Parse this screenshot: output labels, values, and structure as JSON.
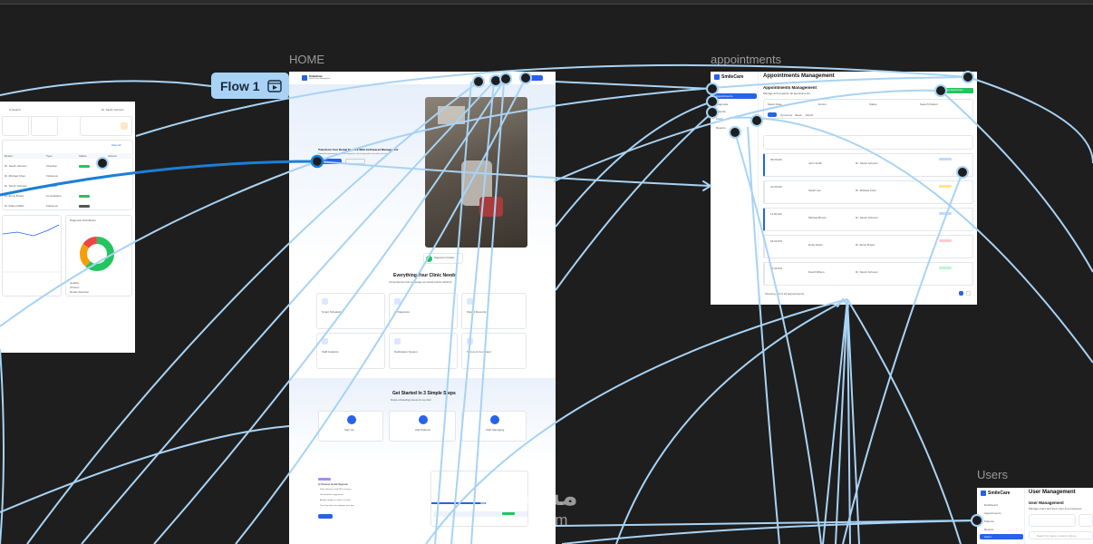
{
  "labels": {
    "home": "HOME",
    "appointments": "appointments",
    "users": "Users"
  },
  "flow": {
    "label": "Flow 1",
    "icon": "play-frame-icon"
  },
  "colors": {
    "canvas": "#1e1e1e",
    "wire": "#a8d3f5",
    "wire_active": "#1b7fd6",
    "accent": "#2563eb",
    "green": "#22c55e"
  },
  "dashboard": {
    "search": "Q  Search",
    "user": "Dr. Sarah Johnson",
    "view_all": "View all",
    "table_headers": [
      "Doctor",
      "Type",
      "Status",
      "Actions"
    ],
    "doctors": [
      "Dr. Sarah Johnson",
      "Dr. Michael Chen",
      "Dr. Sarah Johnson",
      "Dr. Emily Brown",
      "Dr. Robert Miller"
    ],
    "types": [
      "Checkup",
      "Follow-up",
      "Checkup",
      "Consultation",
      "Follow-up"
    ],
    "chart_title": "Diagnosis Distribution",
    "legend": [
      "Healthy",
      "Chronic",
      "Needs Attention"
    ]
  },
  "home": {
    "brand": "SmileCare",
    "tagline": "Dental Clinic Management",
    "hero_title": "Transform Your Dental Practice With AI-Powered Management",
    "hero_sub": "Streamline appointments, automate diagnosis, and manage patient records in one place.",
    "doctor_card": "Diagnosis Complete",
    "features_title": "Everything Your Clinic Needs",
    "features_sub": "Comprehensive tools to manage your dental practice efficiently",
    "features": [
      "Smart Scheduling",
      "AI Diagnosis",
      "Patient Records",
      "Staff Analytics",
      "Notification System",
      "Secure & Compliant"
    ],
    "steps_title": "Get Started In 3 Simple Steps",
    "steps_sub": "Simple onboarding process for any clinic",
    "steps": [
      "Sign Up",
      "Add Patients",
      "Start Managing"
    ],
    "ai_badge": "AI Powered",
    "ai_title": "AI-Powered Dental Diagnosis",
    "ai_points": [
      "Detect diseases with 95% accuracy",
      "Get treatment suggestions",
      "Analyze images in under a second",
      "Track the status of conditions over time"
    ],
    "ai_button": "Learn More"
  },
  "appointments": {
    "brand": "SmileCare",
    "title": "Appointments Management",
    "subtitle": "Manage and organize all appointments",
    "new_button": "+ New Appointment",
    "nav": [
      "Appointments",
      "Diagnosis",
      "Patients",
      "Users",
      "Reports"
    ],
    "filters": [
      "Select Date",
      "Doctor",
      "Status",
      "Search Patient"
    ],
    "tabs": [
      "Today",
      "Tomorrow",
      "Week",
      "Month"
    ],
    "times": [
      "09:00 AM",
      "10:30 AM",
      "11:00 AM",
      "01:00 PM",
      "02:30 PM"
    ],
    "patients": [
      "John Smith",
      "Sarah Lee",
      "Michael Brown",
      "Emily Davis",
      "David Wilson"
    ],
    "doctors": [
      "Dr. Sarah Johnson",
      "Dr. Michael Chen",
      "Dr. Sarah Johnson",
      "Dr. Emily Brown",
      "Dr. Sarah Johnson"
    ],
    "statuses": [
      "Confirmed",
      "Pending",
      "Confirmed",
      "Cancelled",
      "Completed"
    ],
    "footer": "Showing 1-5 of 24 appointments"
  },
  "users": {
    "brand": "SmileCare",
    "title": "User Management",
    "heading": "User Management",
    "sub": "Manage users and their roles & permissions",
    "nav": [
      "Dashboard",
      "Appointments",
      "Patients",
      "Reports",
      "Users"
    ],
    "search": "Search by name, email or phone"
  },
  "watermark": {
    "arabic": "مستقل",
    "latin": "mostaql.com"
  }
}
